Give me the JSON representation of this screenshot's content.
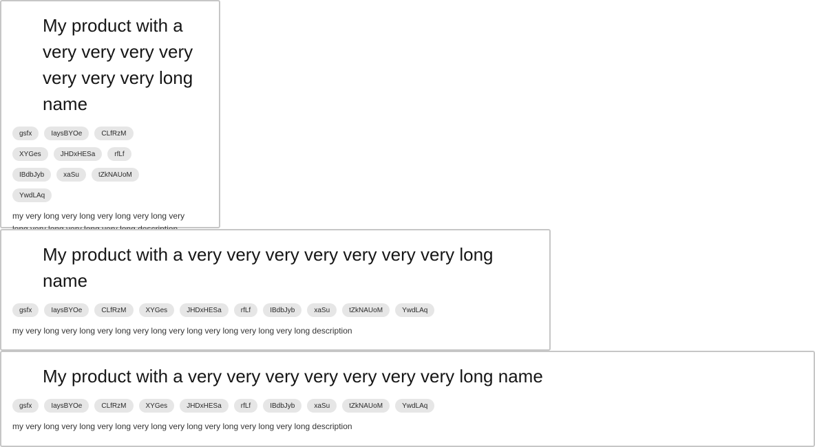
{
  "cards": [
    {
      "title": "My product with a very very very very very very very long name",
      "tags": [
        "gsfx",
        "IaysBYOe",
        "CLfRzM",
        "XYGes",
        "JHDxHESa",
        "rfLf",
        "IBdbJyb",
        "xaSu",
        "tZkNAUoM",
        "YwdLAq"
      ],
      "description": "my very long very long very long very long very long very long very long very long description"
    },
    {
      "title": "My product with a very very very very very very very long name",
      "tags": [
        "gsfx",
        "IaysBYOe",
        "CLfRzM",
        "XYGes",
        "JHDxHESa",
        "rfLf",
        "IBdbJyb",
        "xaSu",
        "tZkNAUoM",
        "YwdLAq"
      ],
      "description": "my very long very long very long very long very long very long very long very long description"
    },
    {
      "title": "My product with a very very very very very very very long name",
      "tags": [
        "gsfx",
        "IaysBYOe",
        "CLfRzM",
        "XYGes",
        "JHDxHESa",
        "rfLf",
        "IBdbJyb",
        "xaSu",
        "tZkNAUoM",
        "YwdLAq"
      ],
      "description": "my very long very long very long very long very long very long very long very long description"
    }
  ]
}
